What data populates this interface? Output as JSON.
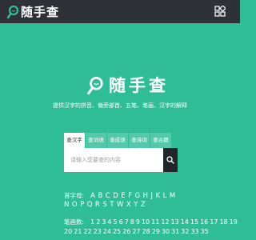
{
  "header": {
    "logo_text": "随手查",
    "menu_icon": "grid-menu-icon"
  },
  "hero": {
    "logo_text": "随手查",
    "subtitle": "提供汉字的拼音、偏旁部首、五笔、笔画、汉字的解释"
  },
  "search": {
    "tabs": [
      {
        "label": "查汉字",
        "active": true
      },
      {
        "label": "查词语",
        "active": false
      },
      {
        "label": "查成语",
        "active": false
      },
      {
        "label": "查诗词",
        "active": false
      },
      {
        "label": "查古籍",
        "active": false
      }
    ],
    "placeholder": "请输入您要查的内容",
    "button_icon": "search-icon"
  },
  "index": {
    "letters_label": "首字母:",
    "letters_row1": [
      "A",
      "B",
      "C",
      "D",
      "E",
      "F",
      "G",
      "H",
      "J",
      "K",
      "L",
      "M"
    ],
    "letters_row2": [
      "N",
      "O",
      "P",
      "Q",
      "R",
      "S",
      "T",
      "W",
      "X",
      "Y",
      "Z"
    ],
    "strokes_label": "笔画数:",
    "strokes_row1": [
      "1",
      "2",
      "3",
      "4",
      "5",
      "6",
      "7",
      "8",
      "9",
      "10",
      "11",
      "12",
      "13",
      "14",
      "15",
      "16",
      "17",
      "18",
      "19"
    ],
    "strokes_row2": [
      "20",
      "21",
      "22",
      "23",
      "24",
      "25",
      "26",
      "27",
      "28",
      "29",
      "30",
      "31",
      "32",
      "33",
      "35"
    ]
  },
  "colors": {
    "background": "#2fbd98",
    "topbar": "#2e3237",
    "search_button": "#22262b"
  }
}
